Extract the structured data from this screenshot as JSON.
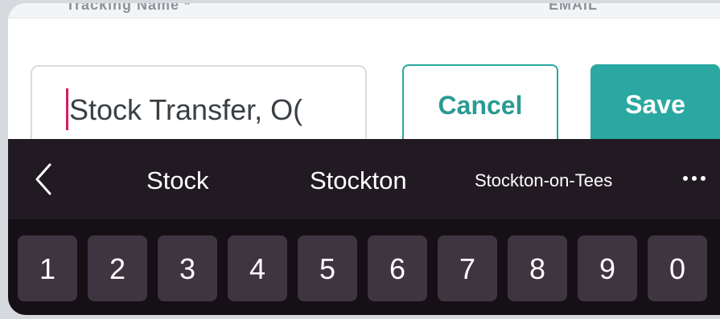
{
  "background_header": {
    "left_text": "Tracking Name *",
    "right_text": "EMAIL"
  },
  "form": {
    "name_input": {
      "value": "Stock Transfer, O(",
      "placeholder": ""
    },
    "cancel_label": "Cancel",
    "save_label": "Save"
  },
  "keyboard": {
    "suggestions": [
      "Stock",
      "Stockton",
      "Stockton-on-Tees"
    ],
    "back_icon": "chevron-left-icon",
    "more_icon": "ellipsis-icon",
    "number_keys": [
      "1",
      "2",
      "3",
      "4",
      "5",
      "6",
      "7",
      "8",
      "9",
      "0"
    ]
  },
  "colors": {
    "accent": "#2aa8a1",
    "caret": "#d81b60",
    "keyboard_bg": "#211a22",
    "key_bg": "#3f3540"
  }
}
